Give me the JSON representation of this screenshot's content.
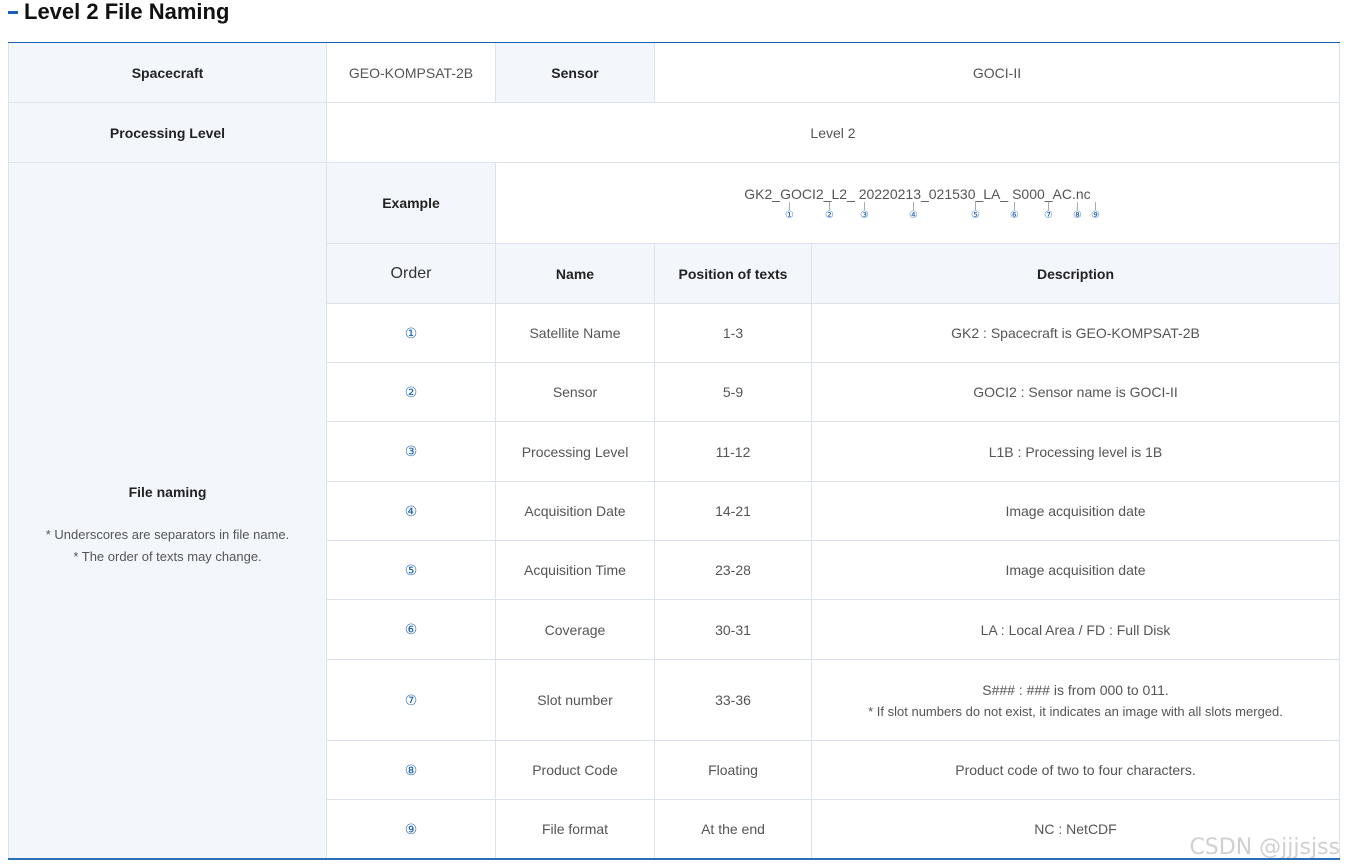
{
  "page": {
    "title": "Level 2 File Naming"
  },
  "info": {
    "spacecraft_label": "Spacecraft",
    "spacecraft_value": "GEO-KOMPSAT-2B",
    "sensor_label": "Sensor",
    "sensor_value": "GOCI-II",
    "processing_label": "Processing Level",
    "processing_value": "Level 2"
  },
  "file_naming": {
    "label": "File naming",
    "note1": "* Underscores are separators in file name.",
    "note2": "* The order of texts may change.",
    "example_label": "Example",
    "example_name": "GK2_GOCI2_L2_ 20220213_021530_LA_ S000_AC.nc",
    "example_marks": [
      "①",
      "②",
      "③",
      "④",
      "⑤",
      "⑥",
      "⑦",
      "⑧",
      "⑨"
    ]
  },
  "table": {
    "headers": {
      "order": "Order",
      "name": "Name",
      "position": "Position of texts",
      "description": "Description"
    },
    "rows": [
      {
        "order": "①",
        "name": "Satellite Name",
        "position": "1-3",
        "description": "GK2 : Spacecraft is GEO-KOMPSAT-2B"
      },
      {
        "order": "②",
        "name": "Sensor",
        "position": "5-9",
        "description": "GOCI2 : Sensor name is GOCI-II"
      },
      {
        "order": "③",
        "name": "Processing Level",
        "position": "11-12",
        "description": "L1B : Processing level is 1B"
      },
      {
        "order": "④",
        "name": "Acquisition Date",
        "position": "14-21",
        "description": "Image acquisition date"
      },
      {
        "order": "⑤",
        "name": "Acquisition Time",
        "position": "23-28",
        "description": "Image acquisition date"
      },
      {
        "order": "⑥",
        "name": "Coverage",
        "position": "30-31",
        "description": "LA : Local Area / FD : Full Disk"
      },
      {
        "order": "⑦",
        "name": "Slot number",
        "position": "33-36",
        "description": "S### : ### is from 000 to 011.",
        "note": "* If  slot numbers do not exist, it indicates an image with all slots merged."
      },
      {
        "order": "⑧",
        "name": "Product Code",
        "position": "Floating",
        "description": "Product code of two to four characters."
      },
      {
        "order": "⑨",
        "name": "File format",
        "position": "At the end",
        "description": "NC : NetCDF"
      }
    ]
  },
  "watermark": "CSDN @jjjsjss"
}
